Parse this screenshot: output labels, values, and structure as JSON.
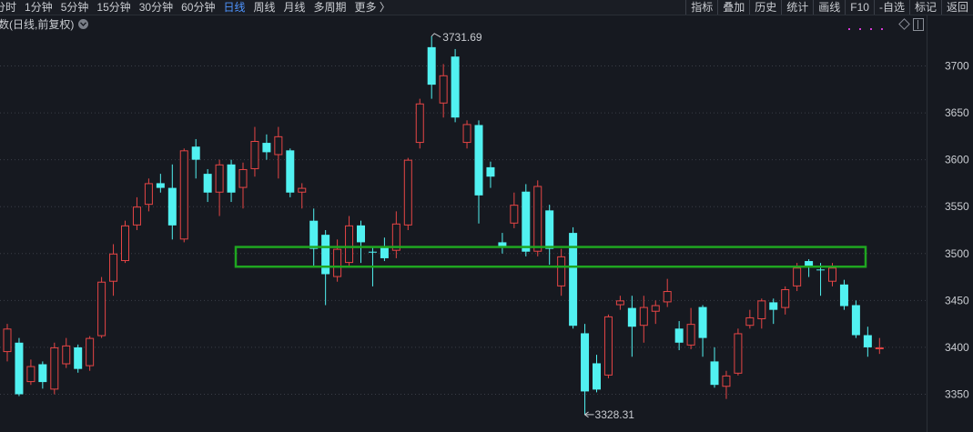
{
  "toolbar": {
    "periods": [
      "分时",
      "1分钟",
      "5分钟",
      "15分钟",
      "30分钟",
      "60分钟",
      "日线",
      "周线",
      "月线",
      "多周期",
      "更多 〉"
    ],
    "active_period": "日线",
    "tools": [
      "指标",
      "叠加",
      "历史",
      "统计",
      "画线",
      "F10",
      "-自选",
      "标记",
      "返回"
    ]
  },
  "chart_title": "数(日线,前复权)",
  "chart_data": {
    "type": "candlestick",
    "yaxis_ticks": [
      3350,
      3400,
      3450,
      3500,
      3550,
      3600,
      3650,
      3700
    ],
    "ylim": [
      3310,
      3755
    ],
    "annotations": {
      "high_label": "3731.69",
      "low_label": "3328.31"
    },
    "highlight_zone": [
      3486,
      3507
    ],
    "candles": [
      {
        "o": 3395,
        "c": 3420,
        "h": 3425,
        "l": 3385,
        "dir": "up"
      },
      {
        "o": 3405,
        "c": 3350,
        "h": 3410,
        "l": 3348,
        "dir": "down"
      },
      {
        "o": 3363,
        "c": 3380,
        "h": 3387,
        "l": 3360,
        "dir": "up"
      },
      {
        "o": 3382,
        "c": 3363,
        "h": 3385,
        "l": 3356,
        "dir": "down"
      },
      {
        "o": 3355,
        "c": 3400,
        "h": 3405,
        "l": 3350,
        "dir": "up"
      },
      {
        "o": 3382,
        "c": 3402,
        "h": 3410,
        "l": 3378,
        "dir": "up"
      },
      {
        "o": 3400,
        "c": 3377,
        "h": 3403,
        "l": 3373,
        "dir": "down"
      },
      {
        "o": 3380,
        "c": 3410,
        "h": 3412,
        "l": 3375,
        "dir": "up"
      },
      {
        "o": 3412,
        "c": 3470,
        "h": 3475,
        "l": 3410,
        "dir": "up"
      },
      {
        "o": 3470,
        "c": 3500,
        "h": 3510,
        "l": 3455,
        "dir": "up"
      },
      {
        "o": 3492,
        "c": 3530,
        "h": 3535,
        "l": 3490,
        "dir": "up"
      },
      {
        "o": 3530,
        "c": 3550,
        "h": 3560,
        "l": 3525,
        "dir": "up"
      },
      {
        "o": 3552,
        "c": 3575,
        "h": 3580,
        "l": 3545,
        "dir": "up"
      },
      {
        "o": 3575,
        "c": 3570,
        "h": 3585,
        "l": 3565,
        "dir": "down"
      },
      {
        "o": 3570,
        "c": 3530,
        "h": 3595,
        "l": 3515,
        "dir": "down"
      },
      {
        "o": 3515,
        "c": 3610,
        "h": 3612,
        "l": 3512,
        "dir": "up"
      },
      {
        "o": 3614,
        "c": 3600,
        "h": 3622,
        "l": 3580,
        "dir": "down"
      },
      {
        "o": 3585,
        "c": 3565,
        "h": 3590,
        "l": 3555,
        "dir": "down"
      },
      {
        "o": 3565,
        "c": 3595,
        "h": 3600,
        "l": 3540,
        "dir": "up"
      },
      {
        "o": 3595,
        "c": 3565,
        "h": 3600,
        "l": 3555,
        "dir": "down"
      },
      {
        "o": 3570,
        "c": 3590,
        "h": 3597,
        "l": 3548,
        "dir": "up"
      },
      {
        "o": 3590,
        "c": 3620,
        "h": 3635,
        "l": 3582,
        "dir": "up"
      },
      {
        "o": 3618,
        "c": 3608,
        "h": 3627,
        "l": 3600,
        "dir": "down"
      },
      {
        "o": 3605,
        "c": 3625,
        "h": 3635,
        "l": 3580,
        "dir": "up"
      },
      {
        "o": 3610,
        "c": 3565,
        "h": 3612,
        "l": 3560,
        "dir": "down"
      },
      {
        "o": 3565,
        "c": 3570,
        "h": 3575,
        "l": 3548,
        "dir": "up"
      },
      {
        "o": 3535,
        "c": 3505,
        "h": 3548,
        "l": 3485,
        "dir": "down"
      },
      {
        "o": 3520,
        "c": 3478,
        "h": 3525,
        "l": 3445,
        "dir": "down"
      },
      {
        "o": 3475,
        "c": 3505,
        "h": 3515,
        "l": 3470,
        "dir": "up"
      },
      {
        "o": 3490,
        "c": 3530,
        "h": 3540,
        "l": 3485,
        "dir": "up"
      },
      {
        "o": 3530,
        "c": 3512,
        "h": 3535,
        "l": 3490,
        "dir": "down"
      },
      {
        "o": 3502,
        "c": 3501,
        "h": 3508,
        "l": 3465,
        "dir": "down"
      },
      {
        "o": 3508,
        "c": 3495,
        "h": 3517,
        "l": 3492,
        "dir": "down"
      },
      {
        "o": 3503,
        "c": 3532,
        "h": 3545,
        "l": 3495,
        "dir": "up"
      },
      {
        "o": 3530,
        "c": 3600,
        "h": 3602,
        "l": 3525,
        "dir": "up"
      },
      {
        "o": 3618,
        "c": 3660,
        "h": 3665,
        "l": 3612,
        "dir": "up"
      },
      {
        "o": 3720,
        "c": 3680,
        "h": 3731.69,
        "l": 3665,
        "dir": "down"
      },
      {
        "o": 3660,
        "c": 3690,
        "h": 3702,
        "l": 3645,
        "dir": "up"
      },
      {
        "o": 3710,
        "c": 3645,
        "h": 3718,
        "l": 3640,
        "dir": "down"
      },
      {
        "o": 3618,
        "c": 3638,
        "h": 3642,
        "l": 3612,
        "dir": "up"
      },
      {
        "o": 3637,
        "c": 3562,
        "h": 3642,
        "l": 3532,
        "dir": "down"
      },
      {
        "o": 3592,
        "c": 3582,
        "h": 3598,
        "l": 3570,
        "dir": "down"
      },
      {
        "o": 3512,
        "c": 3507,
        "h": 3522,
        "l": 3500,
        "dir": "down"
      },
      {
        "o": 3552,
        "c": 3532,
        "h": 3565,
        "l": 3527,
        "dir": "up"
      },
      {
        "o": 3566,
        "c": 3502,
        "h": 3574,
        "l": 3497,
        "dir": "down"
      },
      {
        "o": 3502,
        "c": 3572,
        "h": 3578,
        "l": 3497,
        "dir": "up"
      },
      {
        "o": 3546,
        "c": 3505,
        "h": 3552,
        "l": 3488,
        "dir": "down"
      },
      {
        "o": 3497,
        "c": 3465,
        "h": 3505,
        "l": 3455,
        "dir": "up"
      },
      {
        "o": 3522,
        "c": 3423,
        "h": 3528,
        "l": 3420,
        "dir": "down"
      },
      {
        "o": 3415,
        "c": 3353,
        "h": 3425,
        "l": 3328.31,
        "dir": "down"
      },
      {
        "o": 3383,
        "c": 3355,
        "h": 3392,
        "l": 3352,
        "dir": "down"
      },
      {
        "o": 3370,
        "c": 3433,
        "h": 3435,
        "l": 3367,
        "dir": "up"
      },
      {
        "o": 3445,
        "c": 3450,
        "h": 3455,
        "l": 3440,
        "dir": "up"
      },
      {
        "o": 3442,
        "c": 3422,
        "h": 3455,
        "l": 3390,
        "dir": "down"
      },
      {
        "o": 3423,
        "c": 3443,
        "h": 3455,
        "l": 3405,
        "dir": "up"
      },
      {
        "o": 3438,
        "c": 3445,
        "h": 3450,
        "l": 3425,
        "dir": "up"
      },
      {
        "o": 3448,
        "c": 3460,
        "h": 3473,
        "l": 3443,
        "dir": "up"
      },
      {
        "o": 3420,
        "c": 3405,
        "h": 3428,
        "l": 3397,
        "dir": "down"
      },
      {
        "o": 3402,
        "c": 3425,
        "h": 3442,
        "l": 3398,
        "dir": "up"
      },
      {
        "o": 3443,
        "c": 3410,
        "h": 3445,
        "l": 3390,
        "dir": "down"
      },
      {
        "o": 3385,
        "c": 3360,
        "h": 3400,
        "l": 3357,
        "dir": "down"
      },
      {
        "o": 3358,
        "c": 3370,
        "h": 3375,
        "l": 3345,
        "dir": "up"
      },
      {
        "o": 3372,
        "c": 3415,
        "h": 3420,
        "l": 3370,
        "dir": "up"
      },
      {
        "o": 3423,
        "c": 3432,
        "h": 3440,
        "l": 3420,
        "dir": "up"
      },
      {
        "o": 3430,
        "c": 3450,
        "h": 3452,
        "l": 3420,
        "dir": "up"
      },
      {
        "o": 3448,
        "c": 3440,
        "h": 3452,
        "l": 3425,
        "dir": "down"
      },
      {
        "o": 3442,
        "c": 3462,
        "h": 3465,
        "l": 3435,
        "dir": "up"
      },
      {
        "o": 3465,
        "c": 3485,
        "h": 3490,
        "l": 3460,
        "dir": "up"
      },
      {
        "o": 3492,
        "c": 3487,
        "h": 3494,
        "l": 3475,
        "dir": "down"
      },
      {
        "o": 3483,
        "c": 3483,
        "h": 3490,
        "l": 3455,
        "dir": "down"
      },
      {
        "o": 3485,
        "c": 3470,
        "h": 3490,
        "l": 3465,
        "dir": "up"
      },
      {
        "o": 3467,
        "c": 3444,
        "h": 3472,
        "l": 3440,
        "dir": "down"
      },
      {
        "o": 3445,
        "c": 3413,
        "h": 3450,
        "l": 3410,
        "dir": "down"
      },
      {
        "o": 3413,
        "c": 3400,
        "h": 3422,
        "l": 3390,
        "dir": "down"
      },
      {
        "o": 3398,
        "c": 3400,
        "h": 3410,
        "l": 3393,
        "dir": "up"
      }
    ]
  },
  "colors": {
    "background": "#161920",
    "up": "#e64545",
    "down": "#51f1f1",
    "highlight_box": "#1fa620",
    "grid": "#3a3e47",
    "axis_text": "#c9ccd1"
  }
}
